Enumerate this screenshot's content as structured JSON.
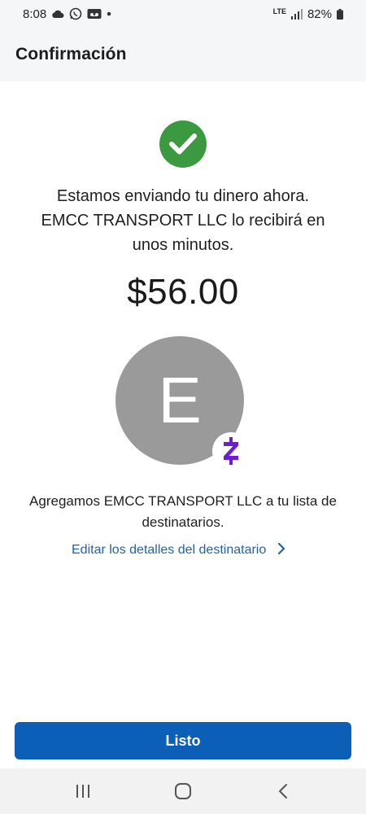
{
  "status_bar": {
    "time": "8:08",
    "icons_left": [
      "cloud-icon",
      "whatsapp-icon",
      "voicemail-icon",
      "dot-icon"
    ],
    "network": "LTE",
    "battery": "82%"
  },
  "header": {
    "title": "Confirmación"
  },
  "confirmation": {
    "status_color": "#3b9a3f",
    "message_lines": [
      "Estamos enviando tu dinero ahora.",
      "EMCC TRANSPORT LLC lo recibirá en",
      "unos minutos."
    ],
    "amount": "$56.00"
  },
  "recipient": {
    "initial": "E",
    "avatar_color": "#9a9a9a",
    "badge": "zelle-icon",
    "badge_color": "#6d1ed4",
    "added_text": "Agregamos EMCC TRANSPORT LLC a tu lista de destinatarios.",
    "edit_link": "Editar los detalles del destinatario"
  },
  "actions": {
    "done_label": "Listo",
    "accent": "#0b5fb7"
  },
  "nav_bar": {
    "buttons": [
      "recent-apps-icon",
      "home-icon",
      "back-icon"
    ]
  }
}
